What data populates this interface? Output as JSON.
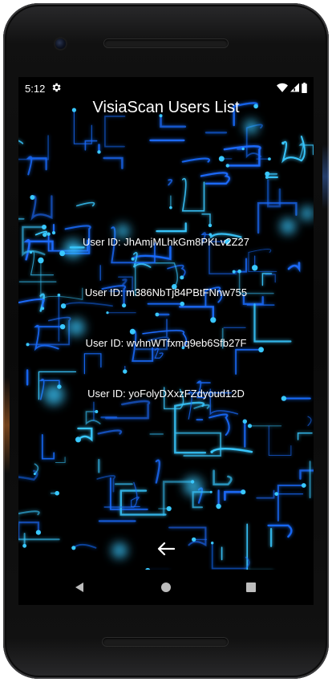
{
  "status_bar": {
    "time": "5:12",
    "icons": [
      "settings-gear-icon",
      "wifi-icon",
      "cell-signal-icon",
      "battery-icon"
    ]
  },
  "app": {
    "title": "VisiaScan Users List",
    "users": [
      {
        "label": "User ID: JhAmjMLhkGm8PKLv2Z27"
      },
      {
        "label": "User ID: m386NbTj84PBtFNnw755"
      },
      {
        "label": "User ID: wvhnWTfxmq9eb6Sfb27F"
      },
      {
        "label": "User ID: yoFolyDXxzFZdyoud12D"
      }
    ],
    "back_icon": "arrow-left-icon"
  },
  "nav_bar": {
    "buttons": [
      "back-triangle-icon",
      "home-circle-icon",
      "recents-square-icon"
    ]
  },
  "colors": {
    "accent_glow": "#39c8ff",
    "circuit_blue": "#1a6cff",
    "text": "#ffffff",
    "background": "#000000"
  }
}
